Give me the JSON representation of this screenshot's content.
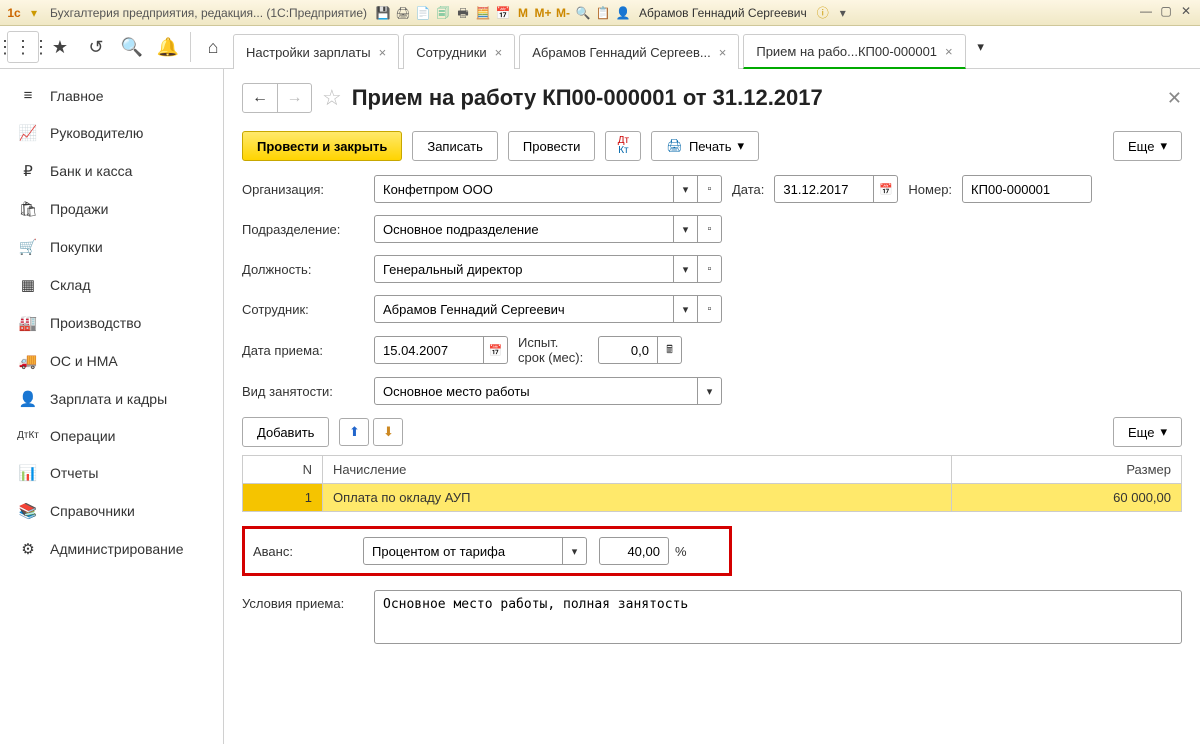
{
  "titlebar": {
    "app_title": "Бухгалтерия предприятия, редакция... (1С:Предприятие)",
    "user_name": "Абрамов Геннадий Сергеевич",
    "m_labels": [
      "M",
      "M+",
      "M-"
    ]
  },
  "tabs": [
    {
      "label": "Настройки зарплаты",
      "active": false
    },
    {
      "label": "Сотрудники",
      "active": false
    },
    {
      "label": "Абрамов Геннадий Сергеев...",
      "active": false
    },
    {
      "label": "Прием на рабо...КП00-000001",
      "active": true
    }
  ],
  "sidebar": [
    {
      "icon": "≡",
      "label": "Главное"
    },
    {
      "icon": "📈",
      "label": "Руководителю"
    },
    {
      "icon": "₽",
      "label": "Банк и касса"
    },
    {
      "icon": "🛍",
      "label": "Продажи"
    },
    {
      "icon": "🛒",
      "label": "Покупки"
    },
    {
      "icon": "▦",
      "label": "Склад"
    },
    {
      "icon": "🏭",
      "label": "Производство"
    },
    {
      "icon": "🚚",
      "label": "ОС и НМА"
    },
    {
      "icon": "👤",
      "label": "Зарплата и кадры"
    },
    {
      "icon": "ДтКт",
      "label": "Операции"
    },
    {
      "icon": "📊",
      "label": "Отчеты"
    },
    {
      "icon": "📚",
      "label": "Справочники"
    },
    {
      "icon": "⚙",
      "label": "Администрирование"
    }
  ],
  "page": {
    "title": "Прием на работу КП00-000001 от 31.12.2017",
    "commands": {
      "post_close": "Провести и закрыть",
      "save": "Записать",
      "post": "Провести",
      "print": "Печать",
      "more": "Еще"
    },
    "fields": {
      "org_label": "Организация:",
      "org_value": "Конфетпром ООО",
      "date_label": "Дата:",
      "date_value": "31.12.2017",
      "num_label": "Номер:",
      "num_value": "КП00-000001",
      "dept_label": "Подразделение:",
      "dept_value": "Основное подразделение",
      "pos_label": "Должность:",
      "pos_value": "Генеральный директор",
      "emp_label": "Сотрудник:",
      "emp_value": "Абрамов Геннадий Сергеевич",
      "hire_date_label": "Дата приема:",
      "hire_date_value": "15.04.2007",
      "trial_label": "Испыт. срок (мес):",
      "trial_value": "0,0",
      "emptype_label": "Вид занятости:",
      "emptype_value": "Основное место работы",
      "advance_label": "Аванс:",
      "advance_type": "Процентом от тарифа",
      "advance_value": "40,00",
      "advance_unit": "%",
      "cond_label": "Условия приема:",
      "cond_value": "Основное место работы, полная занятость"
    },
    "table": {
      "add_btn": "Добавить",
      "more_btn": "Еще",
      "headers": {
        "n": "N",
        "calc": "Начисление",
        "size": "Размер"
      },
      "rows": [
        {
          "n": "1",
          "calc": "Оплата по окладу АУП",
          "size": "60 000,00"
        }
      ]
    }
  }
}
